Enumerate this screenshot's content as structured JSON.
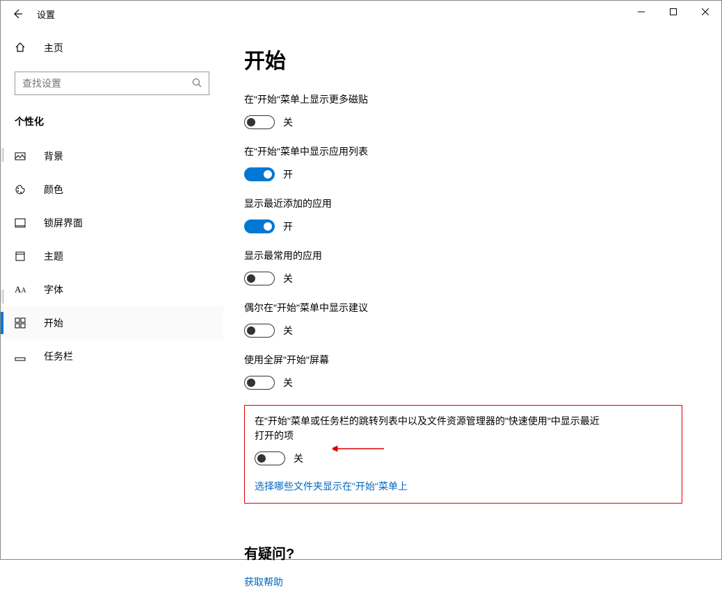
{
  "window": {
    "title": "设置"
  },
  "sidebar": {
    "home": "主页",
    "search_placeholder": "查找设置",
    "section": "个性化",
    "items": [
      {
        "icon": "image-icon",
        "label": "背景"
      },
      {
        "icon": "palette-icon",
        "label": "颜色"
      },
      {
        "icon": "lock-icon",
        "label": "锁屏界面"
      },
      {
        "icon": "theme-icon",
        "label": "主题"
      },
      {
        "icon": "font-icon",
        "label": "字体"
      },
      {
        "icon": "start-icon",
        "label": "开始"
      },
      {
        "icon": "taskbar-icon",
        "label": "任务栏"
      }
    ],
    "active_index": 5
  },
  "page": {
    "title": "开始",
    "settings": [
      {
        "label": "在\"开始\"菜单上显示更多磁贴",
        "state": "关",
        "on": false
      },
      {
        "label": "在\"开始\"菜单中显示应用列表",
        "state": "开",
        "on": true
      },
      {
        "label": "显示最近添加的应用",
        "state": "开",
        "on": true
      },
      {
        "label": "显示最常用的应用",
        "state": "关",
        "on": false
      },
      {
        "label": "偶尔在\"开始\"菜单中显示建议",
        "state": "关",
        "on": false
      },
      {
        "label": "使用全屏\"开始\"屏幕",
        "state": "关",
        "on": false
      },
      {
        "label": "在\"开始\"菜单或任务栏的跳转列表中以及文件资源管理器的\"快速使用\"中显示最近打开的项",
        "state": "关",
        "on": false
      }
    ],
    "folders_link": "选择哪些文件夹显示在\"开始\"菜单上",
    "question_title": "有疑问?",
    "help_link": "获取帮助"
  }
}
